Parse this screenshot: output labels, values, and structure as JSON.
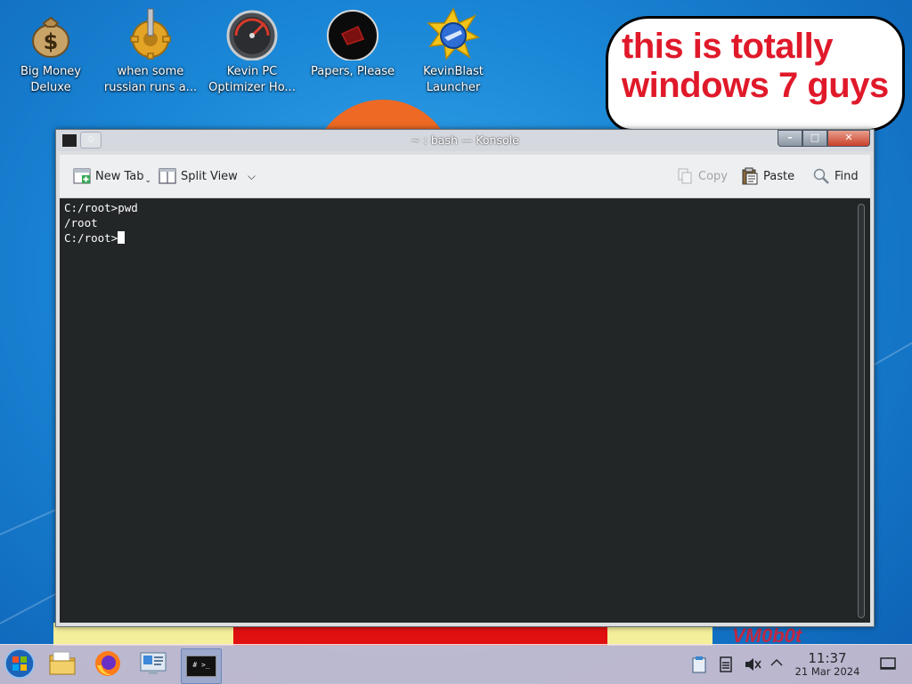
{
  "desktop": {
    "icons": [
      {
        "label": "Big Money Deluxe",
        "icon": "money-bag-icon"
      },
      {
        "label": "when some russian runs a...",
        "icon": "gear-cog-icon"
      },
      {
        "label": "Kevin PC Optimizer Ho...",
        "icon": "speedometer-icon"
      },
      {
        "label": "Papers, Please",
        "icon": "papers-please-icon"
      },
      {
        "label": "KevinBlast Launcher",
        "icon": "kevinblast-icon"
      }
    ],
    "bubble_text": "this is totally windows 7 guys",
    "watermark": "VM0b0t"
  },
  "window": {
    "title": "~ : bash — Konsole",
    "buttons": {
      "minimize": "–",
      "maximize": "□",
      "close": "✕"
    },
    "toolbar": {
      "new_tab": "New Tab",
      "split_view": "Split View",
      "copy": "Copy",
      "paste": "Paste",
      "find": "Find"
    },
    "terminal": {
      "lines": [
        "C:/root>pwd",
        "/root"
      ],
      "prompt": "C:/root>"
    }
  },
  "taskbar": {
    "apps": [
      {
        "name": "start-button",
        "icon": "windows-orb-icon"
      },
      {
        "name": "file-manager",
        "icon": "folder-icon"
      },
      {
        "name": "firefox",
        "icon": "firefox-icon"
      },
      {
        "name": "system-settings",
        "icon": "settings-icon"
      },
      {
        "name": "konsole",
        "icon": "terminal-icon",
        "label": "# >_"
      }
    ],
    "clock": {
      "time": "11:37",
      "date": "21 Mar 2024"
    }
  },
  "colors": {
    "desktop_blue": "#1a86d6",
    "bubble_red": "#e0192a",
    "terminal_bg": "#232627",
    "terminal_fg": "#fcfcfc"
  }
}
